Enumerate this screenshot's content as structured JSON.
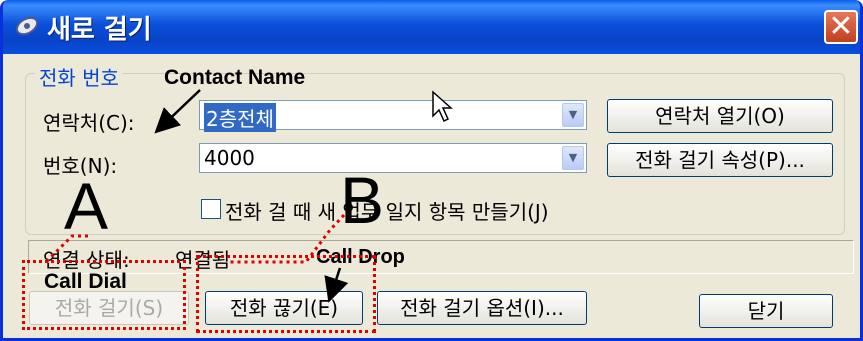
{
  "window": {
    "title": "새로 걸기",
    "close_glyph": "✕",
    "icon": "phone-dial-icon"
  },
  "phone_group": {
    "legend": "전화 번호",
    "contact_label": "연락처(C):",
    "contact_value": "2층전체",
    "open_contact_button": "연락처 열기(O)",
    "number_label": "번호(N):",
    "number_value": "4000",
    "call_properties_button": "전화 걸기 속성(P)...",
    "journal_checkbox_label": "전화 걸 때 새 업무 일지 항목 만들기(J)",
    "journal_checked": false
  },
  "status": {
    "label": "연결 상태:",
    "value": "연결됨"
  },
  "buttons": {
    "start_call": "전화 걸기(S)",
    "end_call": "전화 끊기(E)",
    "dialing_options": "전화 걸기 옵션(I)...",
    "close": "닫기"
  },
  "annotations": {
    "contact_name": "Contact Name",
    "letter_a": "A",
    "letter_b": "B",
    "call_dial": "Call Dial",
    "call_drop": "Call Drop",
    "accent_color": "#e00000"
  },
  "colors": {
    "title_bar": "#0a4fd8",
    "dialog_bg": "#ece9d8",
    "legend_text": "#0046d5",
    "selection": "#316ac5"
  }
}
